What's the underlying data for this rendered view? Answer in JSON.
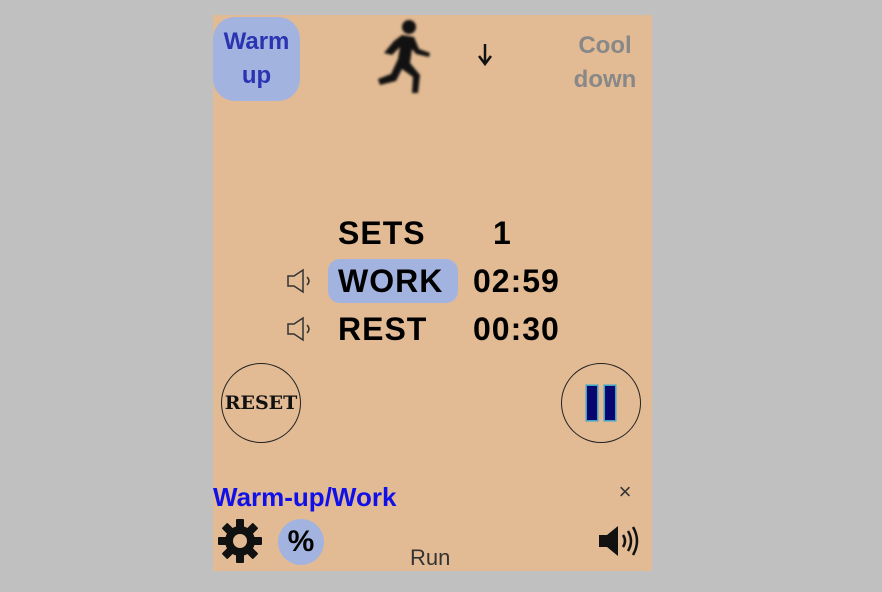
{
  "header": {
    "warmup_line1": "Warm",
    "warmup_line2": "up",
    "cooldown_line1": "Cool",
    "cooldown_line2": "down",
    "runner_icon": "runner-icon",
    "arrow_icon": "down-arrow-icon"
  },
  "timer": {
    "sets_label": "SETS",
    "sets_value": "1",
    "work_label": "WORK",
    "work_value": "02:59",
    "rest_label": "REST",
    "rest_value": "00:30"
  },
  "controls": {
    "reset_label": "RESET",
    "pause_icon": "pause-icon"
  },
  "footer": {
    "mode_title": "Warm-up/Work",
    "close_symbol": "×",
    "percent_label": "%",
    "status_text": "Run"
  },
  "colors": {
    "app_background": "#e2bb94",
    "highlight": "#a3b3e0",
    "mode_title": "#1010e8",
    "pause_bars": "#06066e"
  }
}
